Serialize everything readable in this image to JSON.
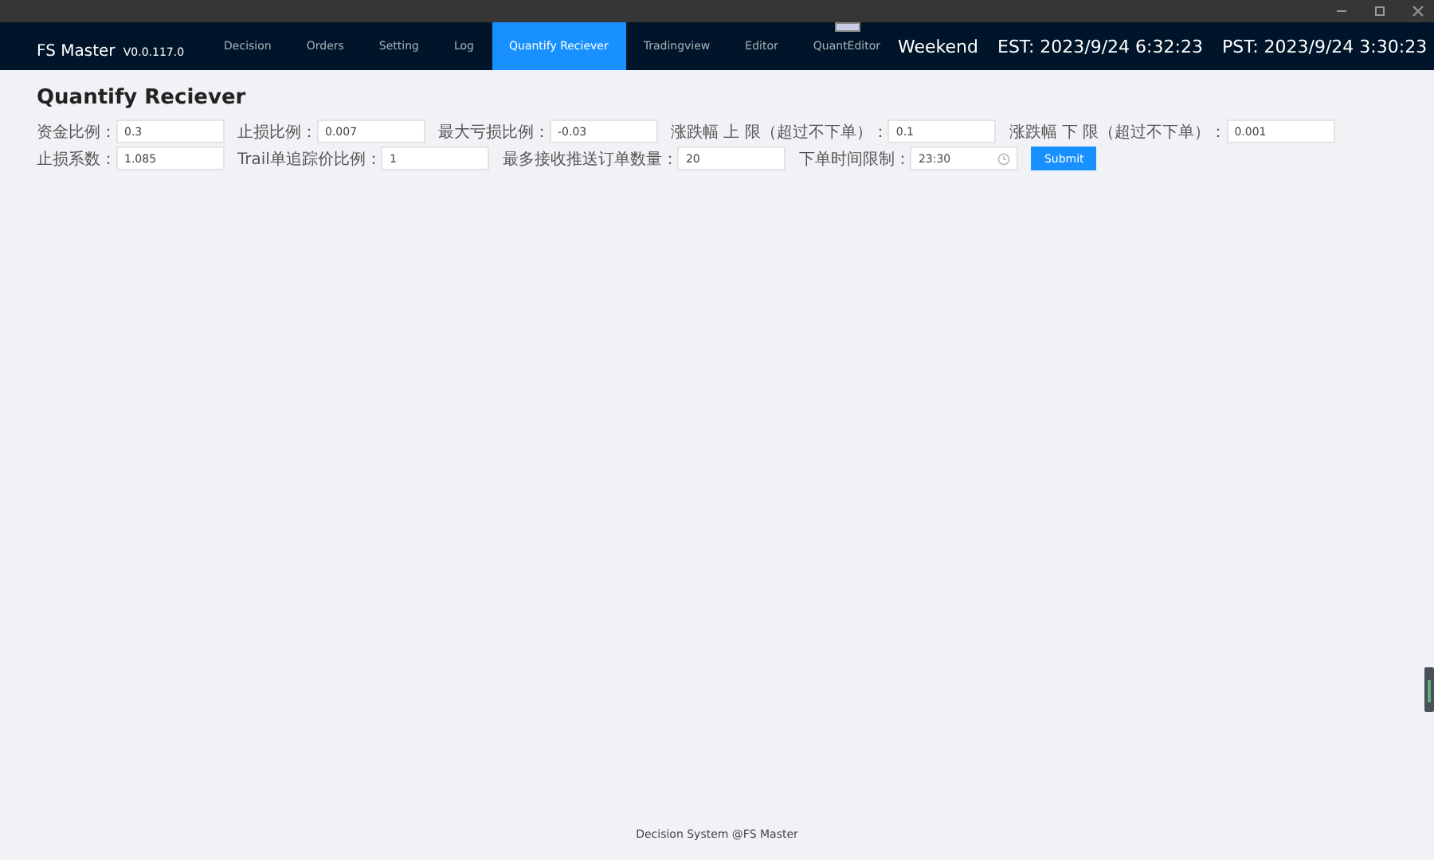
{
  "app": {
    "name": "FS Master",
    "version": "V0.0.117.0"
  },
  "nav": [
    {
      "label": "Decision",
      "selected": false,
      "badge": false
    },
    {
      "label": "Orders",
      "selected": false,
      "badge": false
    },
    {
      "label": "Setting",
      "selected": false,
      "badge": false
    },
    {
      "label": "Log",
      "selected": false,
      "badge": false
    },
    {
      "label": "Quantify Reciever",
      "selected": true,
      "badge": false
    },
    {
      "label": "Tradingview",
      "selected": false,
      "badge": false
    },
    {
      "label": "Editor",
      "selected": false,
      "badge": false
    },
    {
      "label": "QuantEditor",
      "selected": false,
      "badge": true
    }
  ],
  "status": [
    "Weekend",
    "EST: 2023/9/24 6:32:23",
    "PST: 2023/9/24 3:30:23"
  ],
  "page_title": "Quantify Reciever",
  "form_rows": [
    [
      {
        "label": "资金比例：",
        "value": "0.3",
        "kind": "text"
      },
      {
        "label": "止损比例：",
        "value": "0.007",
        "kind": "text"
      },
      {
        "label": "最大亏损比例：",
        "value": "-0.03",
        "kind": "text"
      },
      {
        "label": "涨跌幅 上 限（超过不下单）：",
        "value": "0.1",
        "kind": "text"
      },
      {
        "label": "涨跌幅 下 限（超过不下单）：",
        "value": "0.001",
        "kind": "text"
      }
    ],
    [
      {
        "label": "止损系数：",
        "value": "1.085",
        "kind": "text"
      },
      {
        "label": "Trail单追踪价比例：",
        "value": "1",
        "kind": "text"
      },
      {
        "label": "最多接收推送订单数量：",
        "value": "20",
        "kind": "text"
      },
      {
        "label": "下单时间限制：",
        "value": "23:30",
        "kind": "time"
      }
    ]
  ],
  "submit": "Submit",
  "footer": "Decision System @FS Master"
}
